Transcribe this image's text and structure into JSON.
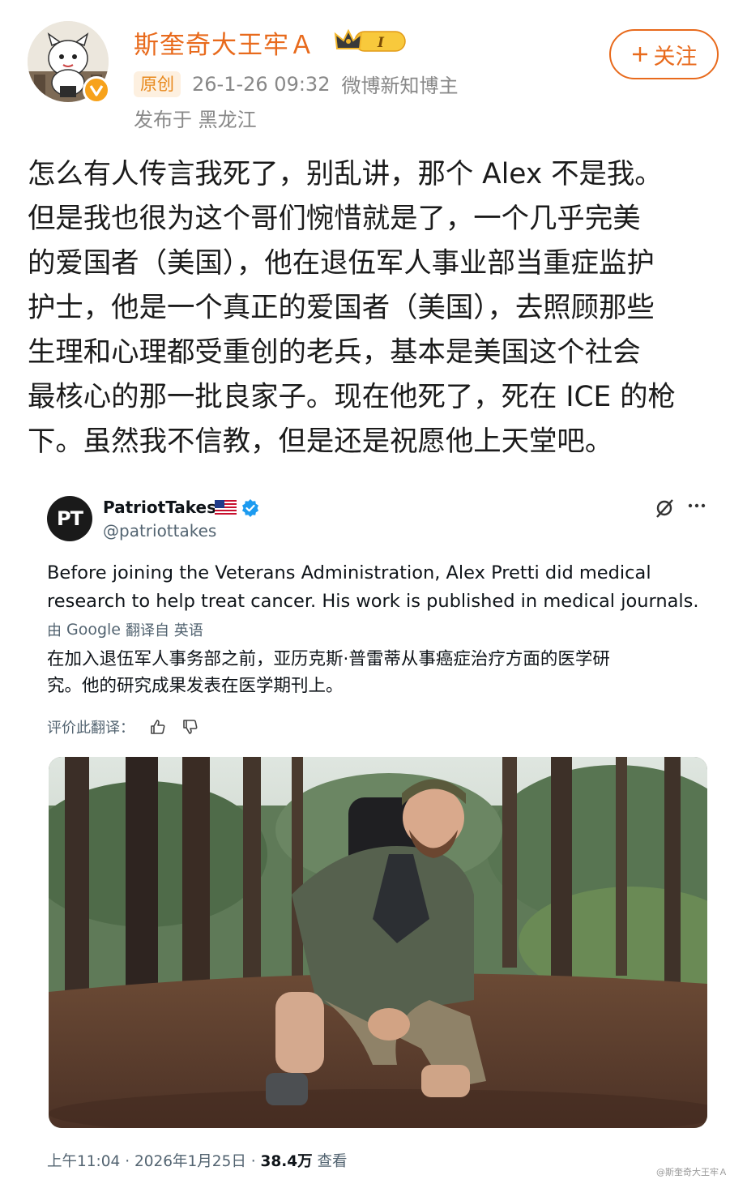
{
  "post": {
    "username": "斯奎奇大王牢Ａ",
    "level_badge": "I",
    "original_tag": "原创",
    "timestamp": "26-1-26 09:32",
    "user_title": "微博新知博主",
    "location": "发布于 黑龙江",
    "follow_label": "关注",
    "body_lines": [
      "怎么有人传言我死了，别乱讲，那个 Alex 不是我。",
      "但是我也很为这个哥们惋惜就是了，一个几乎完美",
      "的爱国者（美国），他在退伍军人事业部当重症监护",
      "护士，他是一个真正的爱国者（美国），去照顾那些",
      "生理和心理都受重创的老兵，基本是美国这个社会",
      "最核心的那一批良家子。现在他死了，死在 ICE 的枪",
      "下。虽然我不信教，但是还是祝愿他上天堂吧。"
    ]
  },
  "tweet": {
    "avatar_text": "PT",
    "name": "PatriotTakes",
    "handle": "@patriottakes",
    "text_lines": [
      "Before joining the Veterans Administration, Alex Pretti did medical",
      "research to help treat cancer. His work is published in medical journals."
    ],
    "translate_prefix": "由",
    "translate_provider": "Google",
    "translate_suffix": "翻译自 英语",
    "translated_lines": [
      "在加入退伍军人事务部之前，亚历克斯·普雷蒂从事癌症治疗方面的医学研",
      "究。他的研究成果发表在医学期刊上。"
    ],
    "rate_label": "评价此翻译：",
    "footer_time": "上午11:04 · 2026年1月25日 ·",
    "views_count": "38.4万",
    "views_label": "查看"
  },
  "watermark": "@斯奎奇大王牢Ａ"
}
